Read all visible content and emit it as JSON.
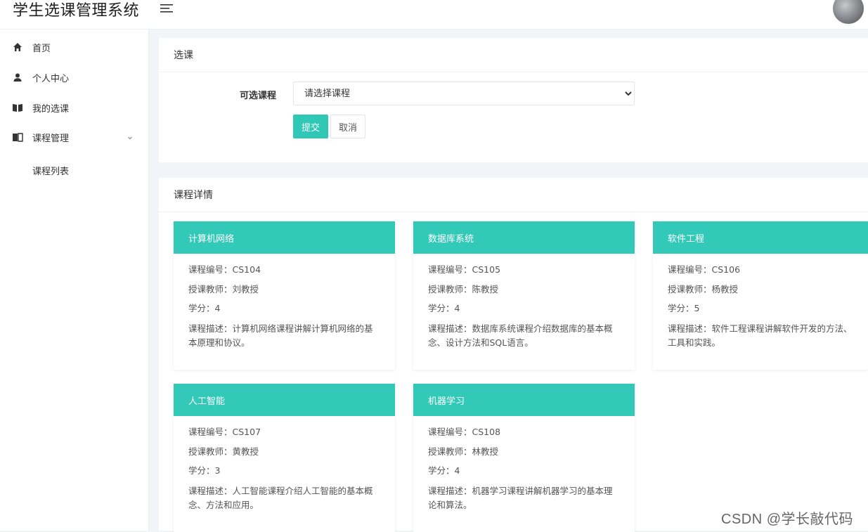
{
  "app": {
    "title": "学生选课管理系统"
  },
  "sidebar": {
    "items": [
      {
        "label": "首页",
        "icon": "home-icon"
      },
      {
        "label": "个人中心",
        "icon": "user-icon"
      },
      {
        "label": "我的选课",
        "icon": "open-book-icon"
      },
      {
        "label": "课程管理",
        "icon": "book-icon"
      },
      {
        "label": "课程列表",
        "icon": ""
      }
    ]
  },
  "select_panel": {
    "title": "选课",
    "field_label": "可选课程",
    "select_value": "请选择课程",
    "submit_label": "提交",
    "cancel_label": "取消"
  },
  "detail_panel": {
    "title": "课程详情",
    "courses": [
      {
        "name": "计算机网络",
        "code": "课程编号：CS104",
        "teacher": "授课教师：刘教授",
        "credit": "学分：4",
        "desc": "课程描述：计算机网络课程讲解计算机网络的基本原理和协议。"
      },
      {
        "name": "数据库系统",
        "code": "课程编号：CS105",
        "teacher": "授课教师：陈教授",
        "credit": "学分：4",
        "desc": "课程描述：数据库系统课程介绍数据库的基本概念、设计方法和SQL语言。"
      },
      {
        "name": "软件工程",
        "code": "课程编号：CS106",
        "teacher": "授课教师：杨教授",
        "credit": "学分：5",
        "desc": "课程描述：软件工程课程讲解软件开发的方法、工具和实践。"
      },
      {
        "name": "人工智能",
        "code": "课程编号：CS107",
        "teacher": "授课教师：黄教授",
        "credit": "学分：3",
        "desc": "课程描述：人工智能课程介绍人工智能的基本概念、方法和应用。"
      },
      {
        "name": "机器学习",
        "code": "课程编号：CS108",
        "teacher": "授课教师：林教授",
        "credit": "学分：4",
        "desc": "课程描述：机器学习课程讲解机器学习的基本理论和算法。"
      }
    ]
  },
  "watermark": "CSDN @学长敲代码",
  "colors": {
    "accent": "#33c9b9",
    "button": "#2fc7b6"
  }
}
